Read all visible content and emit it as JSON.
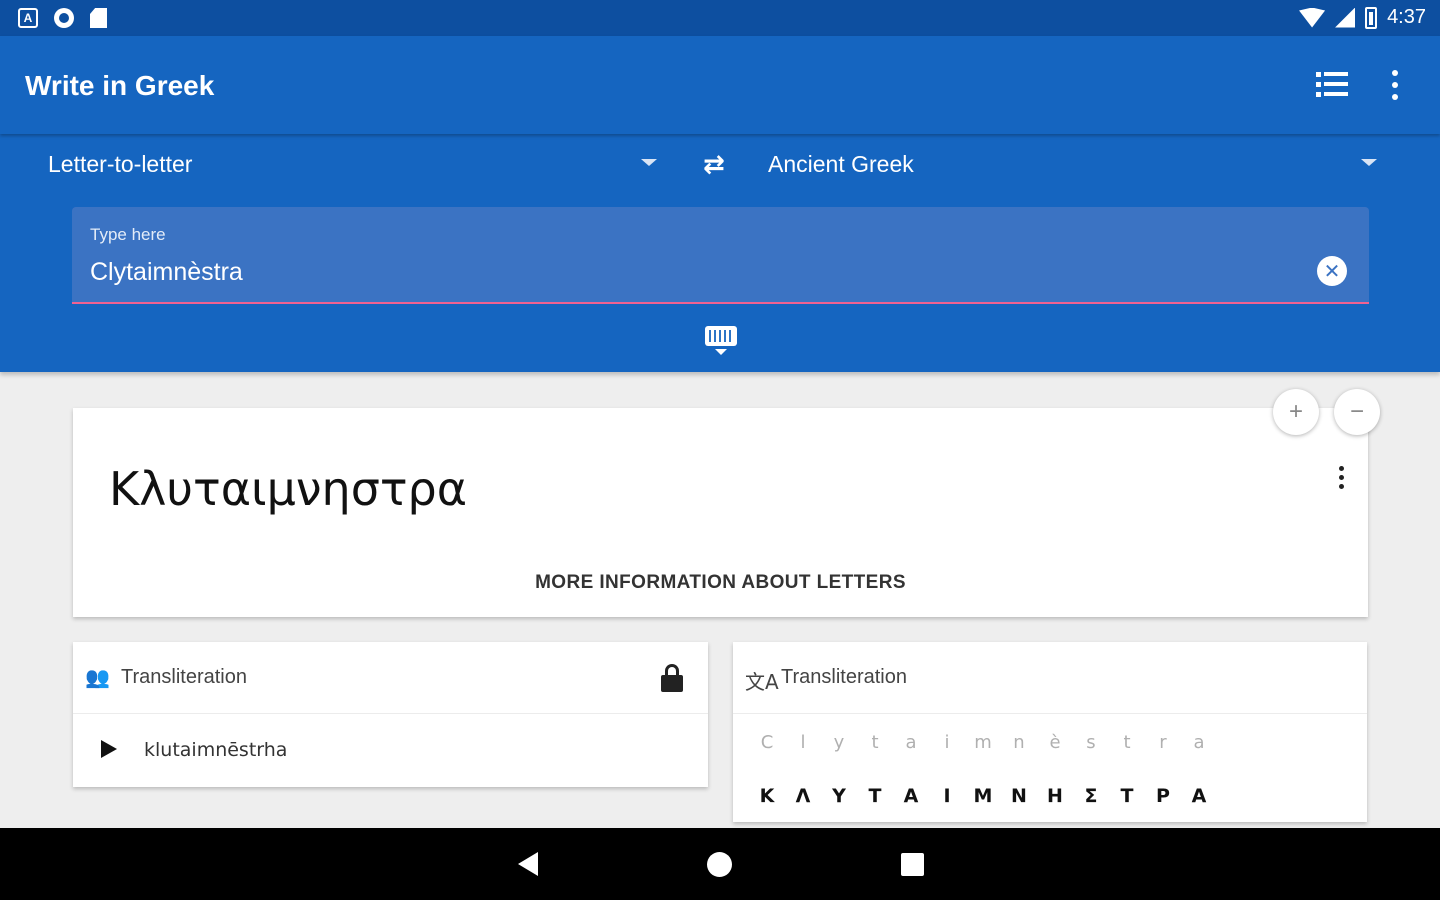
{
  "status_bar": {
    "time": "4:37",
    "left_icons": [
      "app-a-icon",
      "circle-icon",
      "sd-card-icon"
    ],
    "right_icons": [
      "wifi-icon",
      "signal-icon",
      "battery-icon"
    ],
    "a_glyph": "A"
  },
  "app_bar": {
    "title": "Write in Greek",
    "actions": [
      "list-icon",
      "more-vert-icon"
    ]
  },
  "controls": {
    "mode": "Letter-to-letter",
    "swap_icon": "swap-horiz-icon",
    "swap_glyph": "⇄",
    "target_language": "Ancient Greek"
  },
  "input": {
    "label": "Type here",
    "value": "Clytaimnèstra",
    "clear_glyph": "✕"
  },
  "output_card": {
    "greek_text": "Κλυταιμνηστρα",
    "more_info_label": "MORE INFORMATION ABOUT LETTERS"
  },
  "zoom": {
    "plus": "+",
    "minus": "−"
  },
  "transliteration_card": {
    "title": "Transliteration",
    "person_glyph": "👥",
    "value": "klutaimnēstrha"
  },
  "letter_map_card": {
    "title": "Transliteration",
    "translate_glyph": "文A",
    "latin": [
      "C",
      "l",
      "y",
      "t",
      "a",
      "i",
      "m",
      "n",
      "è",
      "s",
      "t",
      "r",
      "a"
    ],
    "greek": [
      "Κ",
      "Λ",
      "Υ",
      "Τ",
      "Α",
      "Ι",
      "Μ",
      "Ν",
      "Η",
      "Σ",
      "Τ",
      "Ρ",
      "Α"
    ]
  },
  "colors": {
    "primary": "#1565c0",
    "status_bar": "#0d4fa0",
    "input_underline": "#f06292"
  }
}
